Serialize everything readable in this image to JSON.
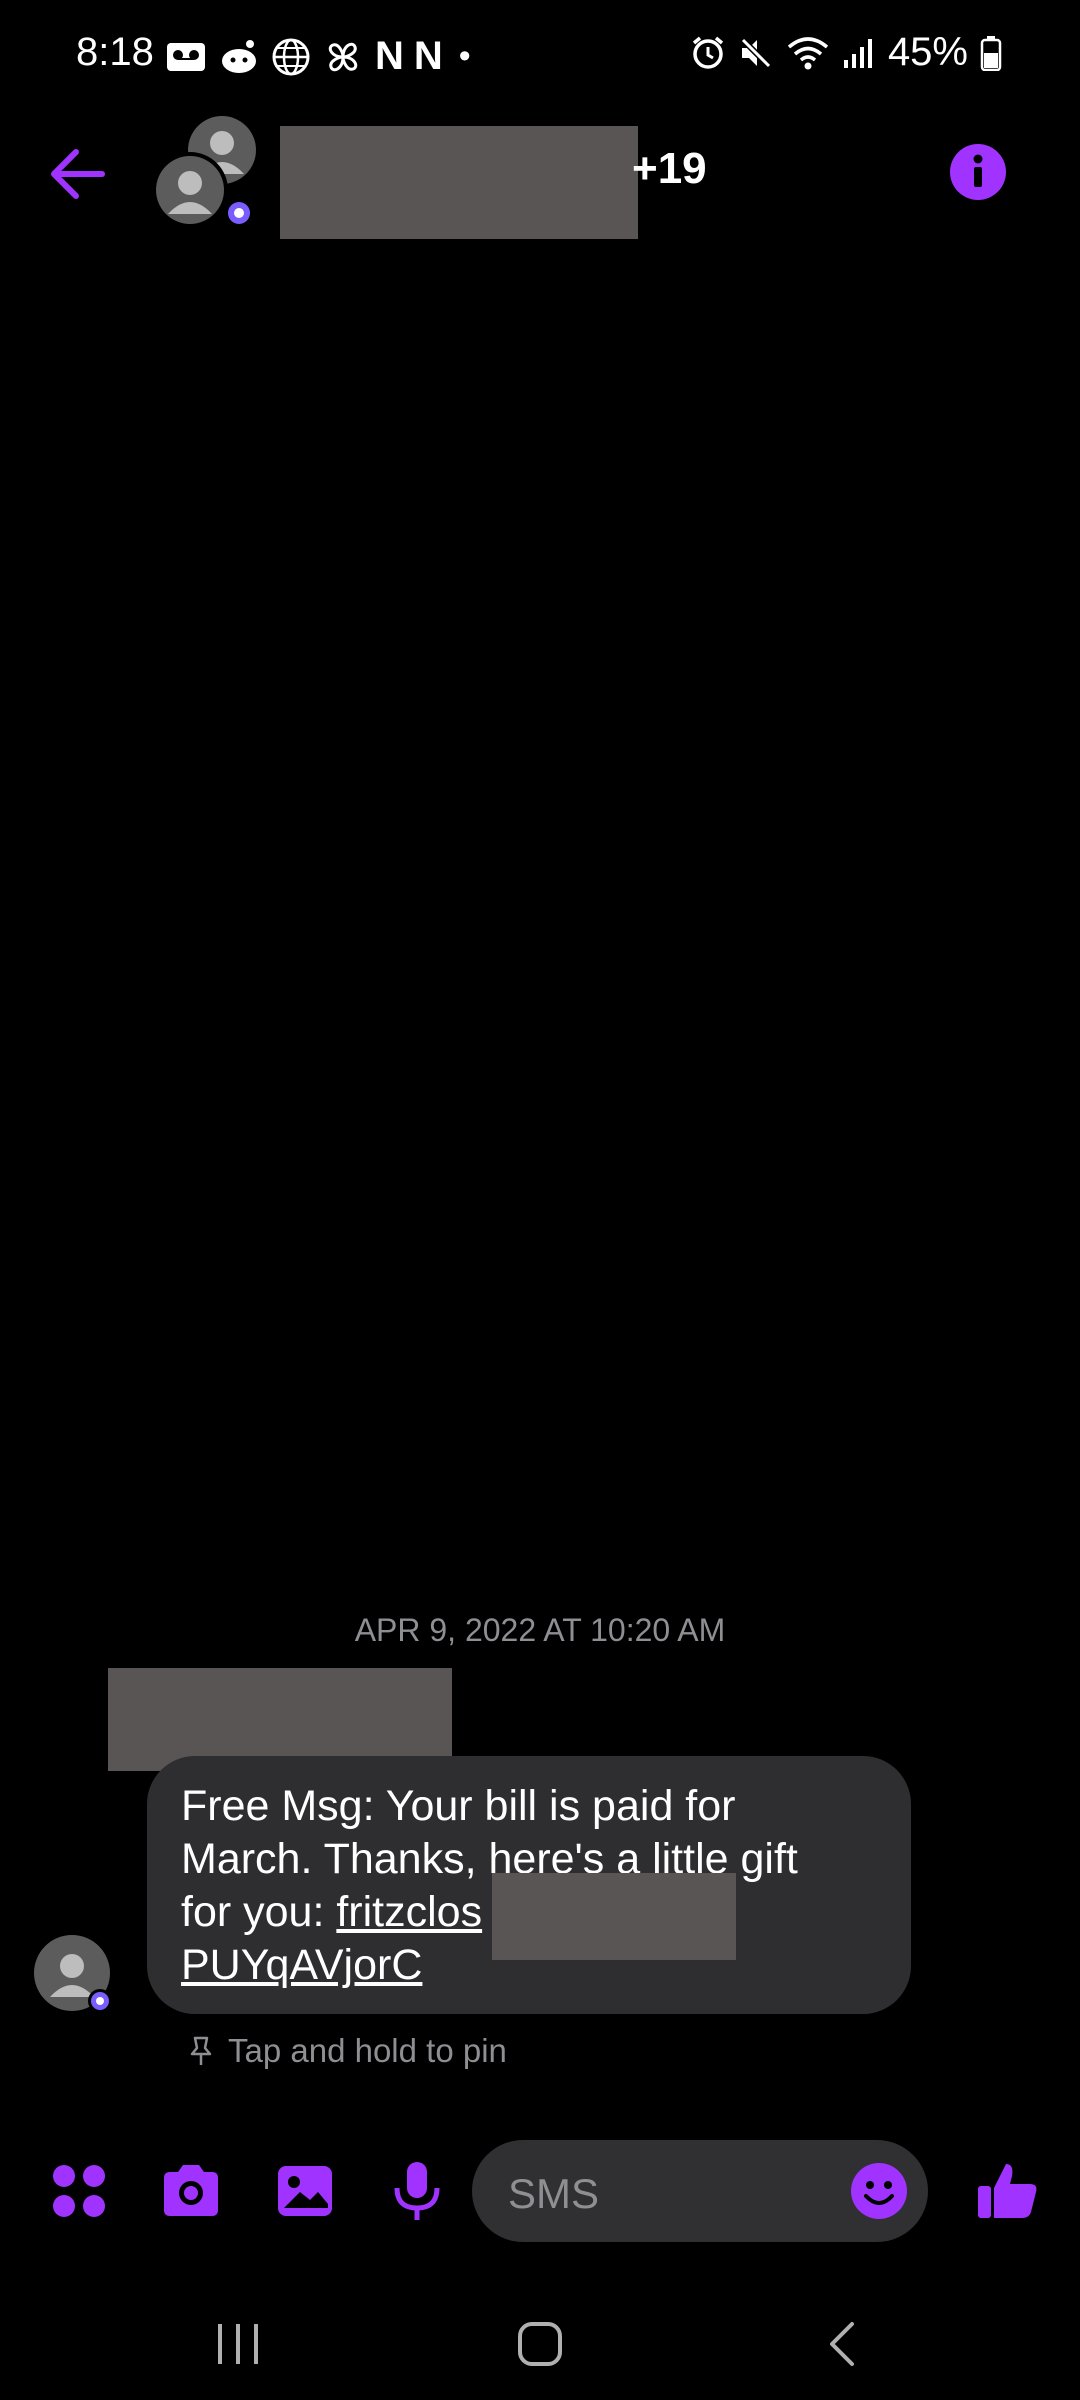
{
  "status_bar": {
    "time": "8:18",
    "battery": "45%",
    "netflix_1": "N",
    "netflix_2": "N",
    "dot": "•"
  },
  "header": {
    "contact_suffix": "+19",
    "back_icon": "arrow-left-icon",
    "info_icon": "info-icon"
  },
  "conversation": {
    "timestamp": "APR 9, 2022 AT 10:20 AM",
    "message": {
      "line1": "Free Msg: Your bill is paid for",
      "line2": "March. Thanks, here's a little gift",
      "line3_prefix": "for you: ",
      "link_part1": "fritzclos",
      "link_part2": "PUYqAVjorC"
    },
    "pin_hint": "Tap and hold to pin"
  },
  "composer": {
    "placeholder": "SMS",
    "icons": [
      "apps-icon",
      "camera-icon",
      "gallery-icon",
      "microphone-icon",
      "emoji-icon",
      "thumbs-up-icon"
    ]
  },
  "colors": {
    "accent": "#a033ff",
    "background": "#000000",
    "bubble": "#2e2e30",
    "redaction": "#595555",
    "muted_text": "#8e8e93"
  }
}
